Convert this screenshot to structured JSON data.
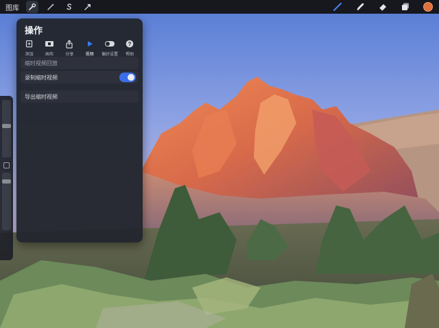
{
  "topbar": {
    "gallery_label": "图库",
    "tools": [
      {
        "name": "actions",
        "icon": "wrench-icon",
        "active": true
      },
      {
        "name": "adjustments",
        "icon": "magic-wand-icon",
        "active": false
      },
      {
        "name": "selection",
        "icon": "selection-s-icon",
        "active": false
      },
      {
        "name": "transform",
        "icon": "arrow-cursor-icon",
        "active": false
      }
    ],
    "right_tools": [
      {
        "name": "brush",
        "icon": "brush-icon",
        "active": true
      },
      {
        "name": "smudge",
        "icon": "smudge-icon",
        "active": false
      },
      {
        "name": "eraser",
        "icon": "eraser-icon",
        "active": false
      },
      {
        "name": "layers",
        "icon": "layers-icon",
        "active": false
      },
      {
        "name": "color",
        "icon": "color-dot-icon",
        "active": false
      }
    ],
    "current_color": "#e0703c",
    "accent_color": "#3a6ee8"
  },
  "panel": {
    "title": "操作",
    "tabs": [
      {
        "label": "添加",
        "icon": "add-file-icon",
        "active": false
      },
      {
        "label": "画布",
        "icon": "canvas-icon",
        "active": false
      },
      {
        "label": "分享",
        "icon": "share-icon",
        "active": false
      },
      {
        "label": "视频",
        "icon": "play-icon",
        "active": true
      },
      {
        "label": "偏好设置",
        "icon": "toggle-icon",
        "active": false
      },
      {
        "label": "帮助",
        "icon": "help-icon",
        "active": false
      }
    ],
    "rows": {
      "timelapse_replay": "缩时视频回放",
      "record_timelapse": "录制缩时视频",
      "record_timelapse_on": true,
      "export_timelapse": "导出缩时视频"
    }
  }
}
